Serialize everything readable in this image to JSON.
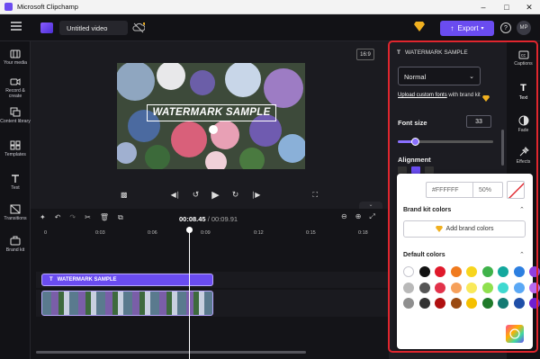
{
  "app": {
    "title": "Microsoft Clipchamp"
  },
  "topbar": {
    "project_name": "Untitled video",
    "export_label": "Export",
    "help_label": "?",
    "avatar_initials": "MP"
  },
  "nav": {
    "items": [
      {
        "label": "Your media",
        "icon": "film-icon"
      },
      {
        "label": "Record & create",
        "icon": "camera-icon"
      },
      {
        "label": "Content library",
        "icon": "library-icon"
      },
      {
        "label": "Templates",
        "icon": "templates-icon"
      },
      {
        "label": "Text",
        "icon": "text-icon"
      },
      {
        "label": "Transitions",
        "icon": "transitions-icon"
      },
      {
        "label": "Brand kit",
        "icon": "brand-kit-icon"
      }
    ]
  },
  "preview": {
    "aspect_ratio": "16:9",
    "overlay_text": "WATERMARK SAMPLE"
  },
  "playback": {
    "current_time": "00:08.45",
    "total_time": "/ 00:09.91"
  },
  "ruler": {
    "ticks": [
      "0",
      "0:03",
      "0:06",
      "0:09",
      "0:12",
      "0:15",
      "0:18"
    ]
  },
  "timeline": {
    "text_clip_label": "WATERMARK SAMPLE"
  },
  "panel": {
    "header": "WATERMARK SAMPLE",
    "style_value": "Normal",
    "upload_fonts_link": "Upload custom fonts",
    "upload_fonts_suffix": " with brand kit",
    "font_size_label": "Font size",
    "font_size_value": "33",
    "alignment_label": "Alignment"
  },
  "rightrail": {
    "items": [
      {
        "label": "Captions",
        "icon": "captions-icon"
      },
      {
        "label": "Text",
        "icon": "text-icon"
      },
      {
        "label": "Fade",
        "icon": "fade-icon"
      },
      {
        "label": "Effects",
        "icon": "effects-icon"
      }
    ]
  },
  "color_popup": {
    "hex_value": "#FFFFFF",
    "opacity_value": "50%",
    "brand_kit_heading": "Brand kit colors",
    "add_brand_label": "Add brand colors",
    "default_heading": "Default colors",
    "swatches": [
      "#ffffff",
      "#111111",
      "#e0192b",
      "#f07a1e",
      "#f7d51e",
      "#3fb24a",
      "#13a89e",
      "#2d7fe0",
      "#8e3fe0",
      "#b9b9b9",
      "#555555",
      "#e2324a",
      "#f6a05a",
      "#f9e95a",
      "#8fe04e",
      "#3fd9d0",
      "#5aa8f5",
      "#b66af0",
      "#8f8f8f",
      "#333333",
      "#b01010",
      "#9a4a12",
      "#f5c000",
      "#1f7a2a",
      "#137a73",
      "#1f4fa8",
      "#6f1fd0"
    ]
  }
}
